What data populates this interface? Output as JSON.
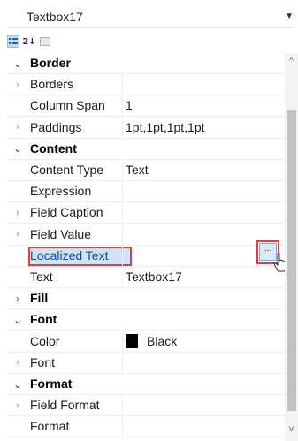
{
  "selector": {
    "object_name": "Textbox17",
    "dropdown_icon": "caret-down-icon"
  },
  "toolbar": {
    "buttons": [
      "categorized-icon",
      "alphabetical-icon",
      "property-pages-icon"
    ],
    "alpha_glyph": "2↓"
  },
  "grid": {
    "rows": [
      {
        "kind": "category",
        "expanded": true,
        "label": "Border",
        "value": ""
      },
      {
        "kind": "property",
        "expandable": true,
        "label": "Borders",
        "value": ""
      },
      {
        "kind": "property",
        "expandable": false,
        "label": "Column Span",
        "value": "1"
      },
      {
        "kind": "property",
        "expandable": true,
        "label": "Paddings",
        "value": "1pt,1pt,1pt,1pt"
      },
      {
        "kind": "category",
        "expanded": true,
        "label": "Content",
        "value": ""
      },
      {
        "kind": "property",
        "expandable": false,
        "label": "Content Type",
        "value": "Text"
      },
      {
        "kind": "property",
        "expandable": false,
        "label": "Expression",
        "value": ""
      },
      {
        "kind": "property",
        "expandable": true,
        "label": "Field Caption",
        "value": ""
      },
      {
        "kind": "property",
        "expandable": true,
        "label": "Field Value",
        "value": ""
      },
      {
        "kind": "property",
        "expandable": false,
        "label": "Localized Text",
        "value": "",
        "selected": true,
        "ellipsis_label": "..."
      },
      {
        "kind": "property",
        "expandable": false,
        "label": "Text",
        "value": "Textbox17"
      },
      {
        "kind": "category",
        "expanded": false,
        "label": "Fill",
        "value": ""
      },
      {
        "kind": "category",
        "expanded": true,
        "label": "Font",
        "value": ""
      },
      {
        "kind": "property",
        "expandable": false,
        "label": "Color",
        "value": "Black",
        "swatch": "#000000"
      },
      {
        "kind": "property",
        "expandable": true,
        "label": "Font",
        "value": ""
      },
      {
        "kind": "category",
        "expanded": true,
        "label": "Format",
        "value": ""
      },
      {
        "kind": "property",
        "expandable": true,
        "label": "Field Format",
        "value": ""
      },
      {
        "kind": "property",
        "expandable": false,
        "label": "Format",
        "value": ""
      }
    ]
  },
  "colors": {
    "highlight": "#e03e3e",
    "selection": "#cde4fa",
    "selected_text": "#0b4f9c"
  }
}
